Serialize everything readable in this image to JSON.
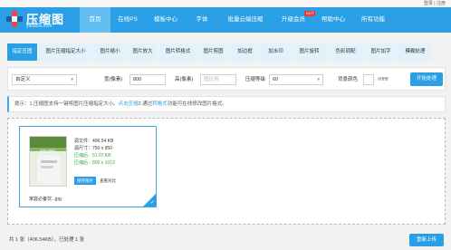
{
  "top_links": "登录 | 注册",
  "logo": {
    "title": "压缩图",
    "subtitle": "yasuotu.com"
  },
  "nav": [
    {
      "label": "首页",
      "active": true
    },
    {
      "label": "在线PS",
      "active": false
    },
    {
      "label": "模板中心",
      "active": false
    },
    {
      "label": "字体",
      "active": false
    },
    {
      "label": "批量云端压缩",
      "active": false
    },
    {
      "label": "升级会员",
      "active": false
    },
    {
      "label": "帮助中心",
      "active": false
    },
    {
      "label": "所有功能",
      "active": false
    }
  ],
  "hot_badge": "HOT",
  "tabs": [
    {
      "label": "指定压图",
      "active": true
    },
    {
      "label": "图片压缩指定大小",
      "active": false
    },
    {
      "label": "图片缩小",
      "active": false
    },
    {
      "label": "图片放大",
      "active": false
    },
    {
      "label": "图片转格式",
      "active": false
    },
    {
      "label": "图片剪图",
      "active": false
    },
    {
      "label": "加边框",
      "active": false
    },
    {
      "label": "加水印",
      "active": false
    },
    {
      "label": "图片旋转",
      "active": false
    },
    {
      "label": "色彩调配",
      "active": false
    },
    {
      "label": "图片加字",
      "active": false
    },
    {
      "label": "模糊处理",
      "active": false
    }
  ],
  "settings": {
    "mode_value": "自定义",
    "width_label": "宽(像素)",
    "width_value": "800",
    "height_label": "高(像素)",
    "height_placeholder": "图比例",
    "level_label": "压缩等级",
    "level_value": "60",
    "bg_label": "背景颜色",
    "bg_value": "#ffffff",
    "process_button": "开始处理"
  },
  "notice": {
    "prefix": "提示：1.压缩图支持一键将图片压缩指定大小。",
    "link1": "点击压缩",
    "middle": "2.通过",
    "link2": "转格式",
    "suffix": "功能可在线修改图片格式。"
  },
  "file": {
    "thumb_caption": "家庭必备饮...",
    "orig_size": "源文件：406.54 KB",
    "orig_dims": "源尺寸：750 x 950",
    "compressed_size": "压缩后：51.07 KB",
    "compressed_dims": "压缩后：800 x 1013",
    "save_button": "保存图片",
    "compare_link": "查看对比",
    "filename": "家庭必备饮...jpg"
  },
  "footer": {
    "summary": "共 1 张（406.54KB），已处理 1 张",
    "reupload_button": "重新上传"
  },
  "colors": {
    "primary": "#2b9fe6",
    "nav_active": "#64bff0",
    "success": "#3aab3a",
    "hot": "#e63c3c"
  }
}
